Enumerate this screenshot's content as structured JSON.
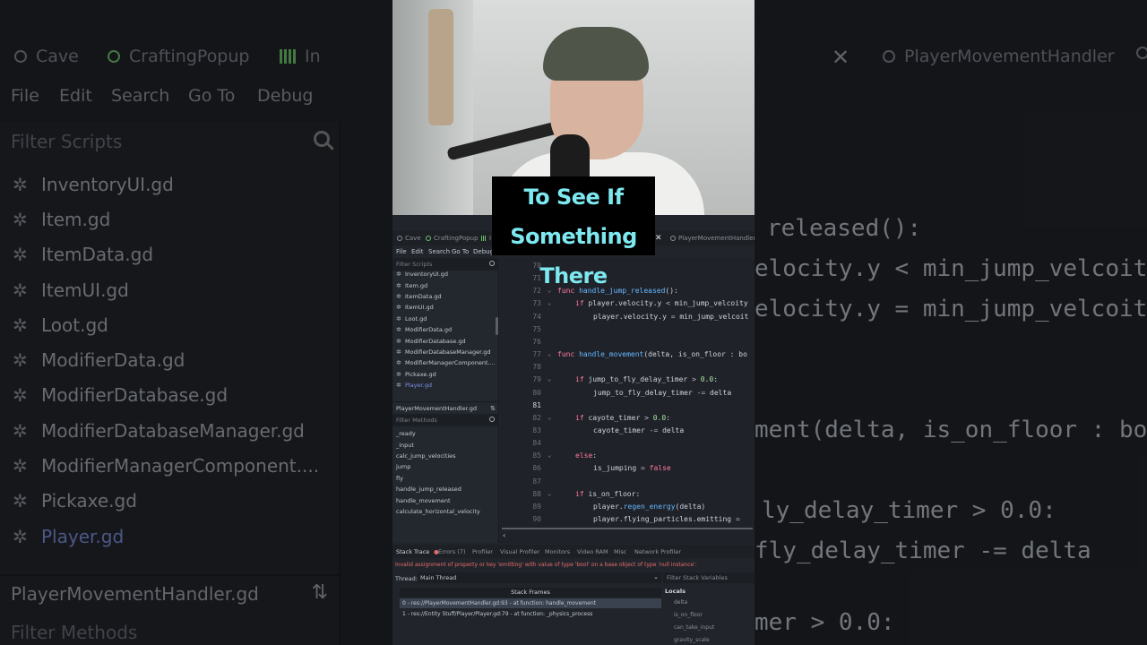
{
  "background": {
    "tabs": [
      "Cave",
      "CraftingPopup",
      "In",
      "PlayerMovementHandler"
    ],
    "menu": [
      "File",
      "Edit",
      "Search",
      "Go To",
      "Debug"
    ],
    "filter_placeholder": "Filter Scripts",
    "scripts": [
      "InventoryUI.gd",
      "Item.gd",
      "ItemData.gd",
      "ItemUI.gd",
      "Loot.gd",
      "ModifierData.gd",
      "ModifierDatabase.gd",
      "ModifierDatabaseManager.gd",
      "ModifierManagerComponent....",
      "Pickaxe.gd",
      "Player.gd"
    ],
    "current_file": "PlayerMovementHandler.gd",
    "filter_methods": "Filter Methods",
    "code_lines": [
      "released():",
      "elocity.y < min_jump_velcoity",
      "elocity.y = min_jump_velcoit",
      "ment(delta, is_on_floor : bo",
      "ly_delay_timer > 0.0:",
      "fly_delay_timer -= delta",
      "mer > 0.0:"
    ]
  },
  "caption": {
    "line1": "To See If There's",
    "line2": "Something There"
  },
  "editor": {
    "tabs": [
      "Cave",
      "CraftingPopup",
      "I",
      "PlayerMovementHandler"
    ],
    "menu": [
      "File",
      "Edit",
      "Search",
      "Go To",
      "Debug"
    ],
    "filter_scripts_placeholder": "Filter Scripts",
    "scripts": [
      "InventoryUI.gd",
      "Item.gd",
      "ItemData.gd",
      "ItemUI.gd",
      "Loot.gd",
      "ModifierData.gd",
      "ModifierDatabase.gd",
      "ModifierDatabaseManager.gd",
      "ModifierManagerComponent....",
      "Pickaxe.gd",
      "Player.gd"
    ],
    "selected_script": "Player.gd",
    "current_file": "PlayerMovementHandler.gd",
    "filter_methods_placeholder": "Filter Methods",
    "methods": [
      "_ready",
      "_input",
      "calc_jump_velocities",
      "jump",
      "fly",
      "handle_jump_released",
      "handle_movement",
      "calculate_horizontal_velocity"
    ],
    "code": [
      {
        "n": "70",
        "text": ""
      },
      {
        "n": "71",
        "text": ""
      },
      {
        "n": "72",
        "text": "func handle_jump_released():"
      },
      {
        "n": "73",
        "text": "if player.velocity.y < min_jump_velcoity"
      },
      {
        "n": "74",
        "text": "player.velocity.y = min_jump_velcoit"
      },
      {
        "n": "75",
        "text": ""
      },
      {
        "n": "76",
        "text": ""
      },
      {
        "n": "77",
        "text": "func handle_movement(delta, is_on_floor : bo"
      },
      {
        "n": "78",
        "text": ""
      },
      {
        "n": "79",
        "text": "if jump_to_fly_delay_timer > 0.0:"
      },
      {
        "n": "80",
        "text": "jump_to_fly_delay_timer -= delta"
      },
      {
        "n": "81",
        "text": ""
      },
      {
        "n": "82",
        "text": "if cayote_timer > 0.0:"
      },
      {
        "n": "83",
        "text": "cayote_timer -= delta"
      },
      {
        "n": "84",
        "text": ""
      },
      {
        "n": "85",
        "text": "else:"
      },
      {
        "n": "86",
        "text": "is_jumping = false"
      },
      {
        "n": "87",
        "text": ""
      },
      {
        "n": "88",
        "text": "if is_on_floor:"
      },
      {
        "n": "89",
        "text": "player.regen_energy(delta)"
      },
      {
        "n": "90",
        "text": "player.flying_particles.emitting = "
      }
    ]
  },
  "debugger": {
    "tabs": [
      "Stack Trace",
      "Errors (7)",
      "Profiler",
      "Visual Profiler",
      "Monitors",
      "Video RAM",
      "Misc",
      "Network Profiler"
    ],
    "error_message": "Invalid assignment of property or key 'emitting' with value of type 'bool' on a base object of type 'null instance'.",
    "thread_label": "Thread:",
    "thread_value": "Main Thread",
    "stack_frames_title": "Stack Frames",
    "frames": [
      "0 - res://PlayerMovementHandler.gd:93 - at function: handle_movement",
      "1 - res://Entity Stuff/Player/Player.gd:79 - at function: _physics_process"
    ],
    "filter_stack_vars": "Filter Stack Variables",
    "locals_title": "Locals",
    "locals": [
      "delta",
      "is_on_floor",
      "can_take_input",
      "gravity_scale"
    ]
  },
  "colors": {
    "keyword": "#ff7aa0",
    "function": "#66b8ff",
    "caption": "#7ee8f0",
    "error": "#e66b6b",
    "selected_script": "#7f93e6"
  }
}
